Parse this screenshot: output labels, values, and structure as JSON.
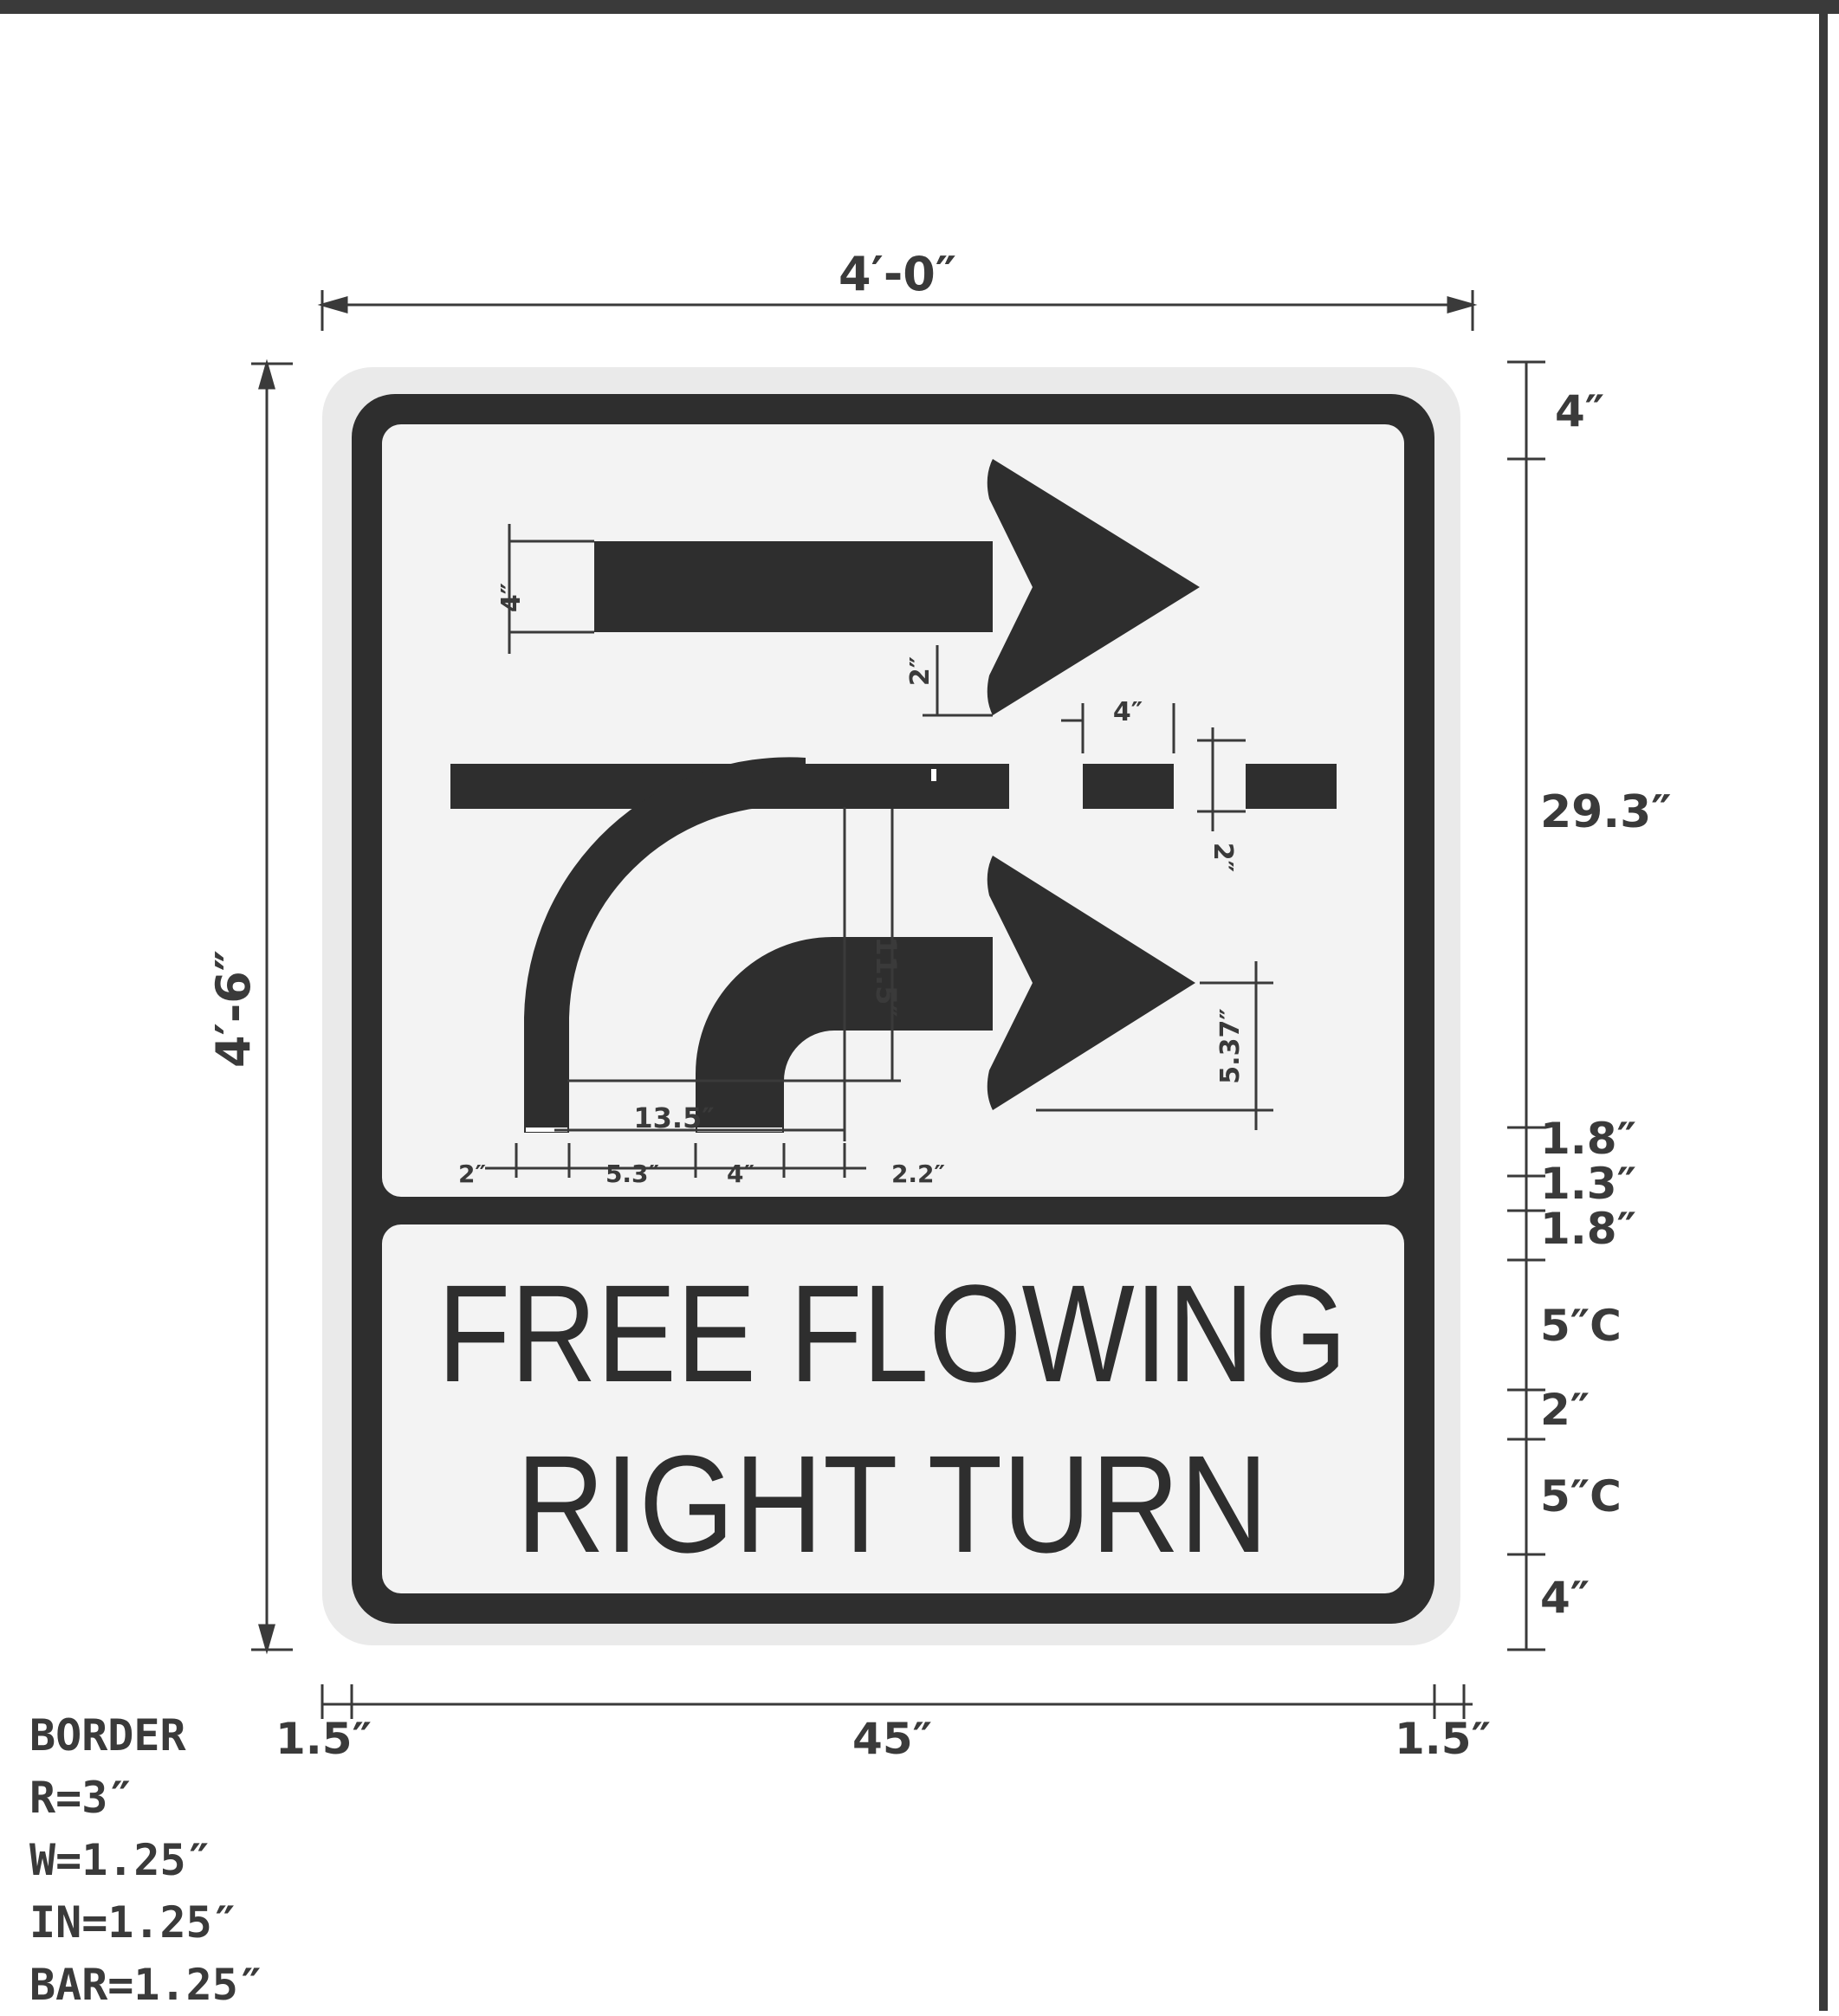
{
  "sign": {
    "legend_line1": "FREE FLOWING",
    "legend_line2": "RIGHT TURN"
  },
  "dimensions": {
    "overall_width": "4′-0″",
    "overall_height": "4′-6″",
    "right_top": "4″",
    "right_symbol_panel": "29.3″",
    "right_gap_1": "1.8″",
    "right_bar": "1.3″",
    "right_gap_2": "1.8″",
    "right_line1": "5″C",
    "right_line_gap": "2″",
    "right_line2": "5″C",
    "right_bottom": "4″",
    "bottom_left_margin": "1.5″",
    "bottom_center": "45″",
    "bottom_right_margin": "1.5″",
    "arrow_shaft": "4″",
    "arrow_head_offset": "2″",
    "lane_block_width": "4″",
    "lane_gap": "2″",
    "curve_radius": "11.5″",
    "curve_span": "13.5″",
    "arrow_head_half": "5.37″",
    "bottom_2": "2″",
    "bottom_5_3": "5.3″",
    "bottom_4": "4″",
    "bottom_2_2": "2.2″"
  },
  "border_notes": [
    "BORDER",
    "R=3″",
    "W=1.25″",
    "IN=1.25″",
    "BAR=1.25″"
  ],
  "colors": {
    "ink": "#2e2e2e",
    "sign_face": "#f3f3f3",
    "sign_edge": "#e6e6e6",
    "frame": "#3a3a3a"
  }
}
